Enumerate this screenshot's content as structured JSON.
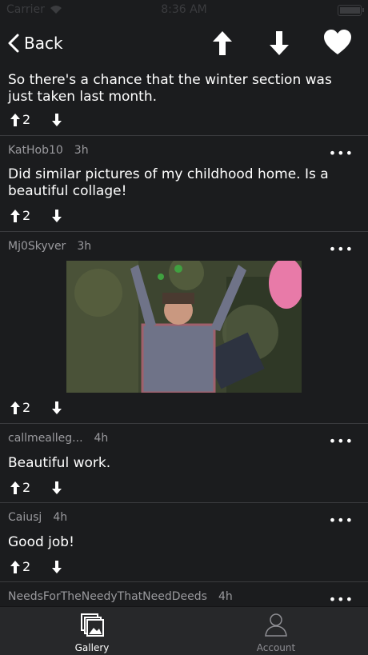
{
  "status_bar": {
    "carrier": "Carrier",
    "time": "8:36 AM",
    "battery_level": 0.9
  },
  "nav": {
    "back_label": "Back",
    "up_icon": "arrow-up-icon",
    "down_icon": "arrow-down-icon",
    "favorite_icon": "heart-icon"
  },
  "post": {
    "body": "So there's a chance that the winter section was just taken last month.",
    "upvotes": "2"
  },
  "comments": [
    {
      "author": "KatHob10",
      "time": "3h",
      "body": "Did similar pictures of my childhood home. Is a beautiful collage!",
      "upvotes": "2"
    },
    {
      "author": "Mj0Skyver",
      "time": "3h",
      "body": "",
      "image": "celebration-gif",
      "upvotes": "2"
    },
    {
      "author": "callmealleg...",
      "time": "4h",
      "body": "Beautiful work.",
      "upvotes": "2"
    },
    {
      "author": "Caiusj",
      "time": "4h",
      "body": "Good job!",
      "upvotes": "2"
    },
    {
      "author": "NeedsForTheNeedyThatNeedDeeds",
      "time": "4h",
      "body": "",
      "upvotes": ""
    }
  ],
  "more_label": "•••",
  "tabs": [
    {
      "label": "Gallery",
      "icon": "gallery-icon",
      "active": true
    },
    {
      "label": "Account",
      "icon": "account-icon",
      "active": false
    }
  ],
  "colors": {
    "background": "#1b1c1e",
    "tab_bar": "#27282a",
    "meta_text": "#9a9a9e",
    "inactive_tab": "#8e8e93"
  }
}
